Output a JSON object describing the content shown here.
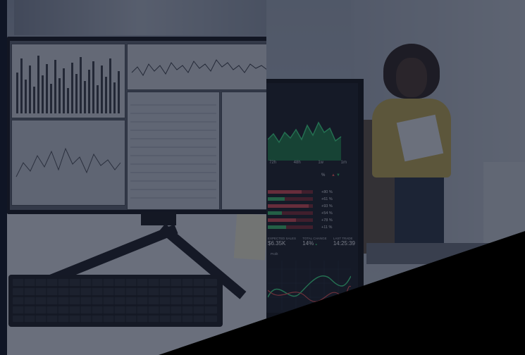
{
  "trading_screen": {
    "time_labels": [
      "72h",
      "48h",
      "1w",
      "1m"
    ],
    "percent_header": "%",
    "percent_changes": [
      "+80 %",
      "+61 %",
      "+93 %",
      "+54 %",
      "+78 %",
      "+11 %"
    ],
    "stats": [
      {
        "label": "EXPECTED SALES",
        "value": "$6.35K"
      },
      {
        "label": "TOTAL CHANGE",
        "value": "14%"
      },
      {
        "label": "LAST TRADE",
        "value": "14:25:39"
      }
    ],
    "wave_title": "Profit"
  },
  "colors": {
    "overlay": "#101628",
    "up_green": "#32c46a",
    "down_red": "#e05252",
    "wedge": "#000000"
  },
  "icons": {
    "arrow_up": "triangle-up-red-icon",
    "arrow_down": "triangle-down-green-icon"
  }
}
